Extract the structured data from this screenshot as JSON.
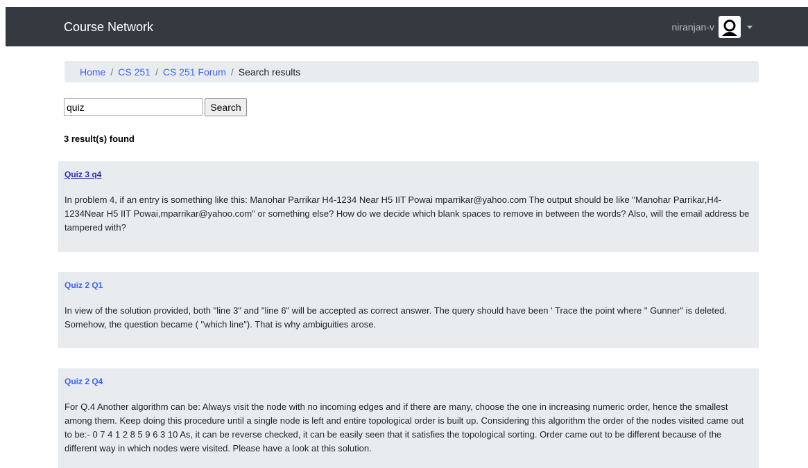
{
  "navbar": {
    "brand": "Course Network",
    "username": "niranjan-v"
  },
  "breadcrumb": {
    "items": [
      "Home",
      "CS 251",
      "CS 251 Forum"
    ],
    "separator": "/",
    "current": "Search results"
  },
  "search": {
    "value": "quiz",
    "button_label": "Search"
  },
  "result_count": "3 result(s) found",
  "results": [
    {
      "title": "Quiz 3 q4",
      "body": "In problem 4, if an entry is something like this: Manohar Parrikar H4-1234 Near H5 IIT Powai mparrikar@yahoo.com The output should be like \"Manohar Parrikar,H4-1234Near H5 IIT Powai,mparrikar@yahoo.com\" or something else? How do we decide which blank spaces to remove in between the words? Also, will the email address be tampered with?"
    },
    {
      "title": "Quiz 2 Q1",
      "body": "In view of the solution provided, both \"line 3\" and \"line 6\" will be accepted as correct answer. The query should have been ' Trace the point where \" Gunner\" is deleted. Somehow, the question became ( \"which line\"). That is why ambiguities arose."
    },
    {
      "title": "Quiz 2 Q4",
      "body": "For Q.4 Another algorithm can be: Always visit the node with no incoming edges and if there are many, choose the one in increasing numeric order, hence the smallest among them. Keep doing this procedure until a single node is left and entire topological order is built up. Considering this algorithm the order of the nodes visited came out to be:- 0 7 4 1 2 8 5 9 6 3 10 As, it can be reverse checked, it can be easily seen that it satisfies the topological sorting. Order came out to be different because of the different way in which nodes were visited. Please have a look at this solution."
    }
  ],
  "colors": {
    "navbar_bg": "#343a40",
    "link": "#3b63ff",
    "panel_bg": "#e9ecef"
  },
  "icons": {
    "avatar": "user-avatar-icon",
    "menu": "caret-down-icon"
  }
}
